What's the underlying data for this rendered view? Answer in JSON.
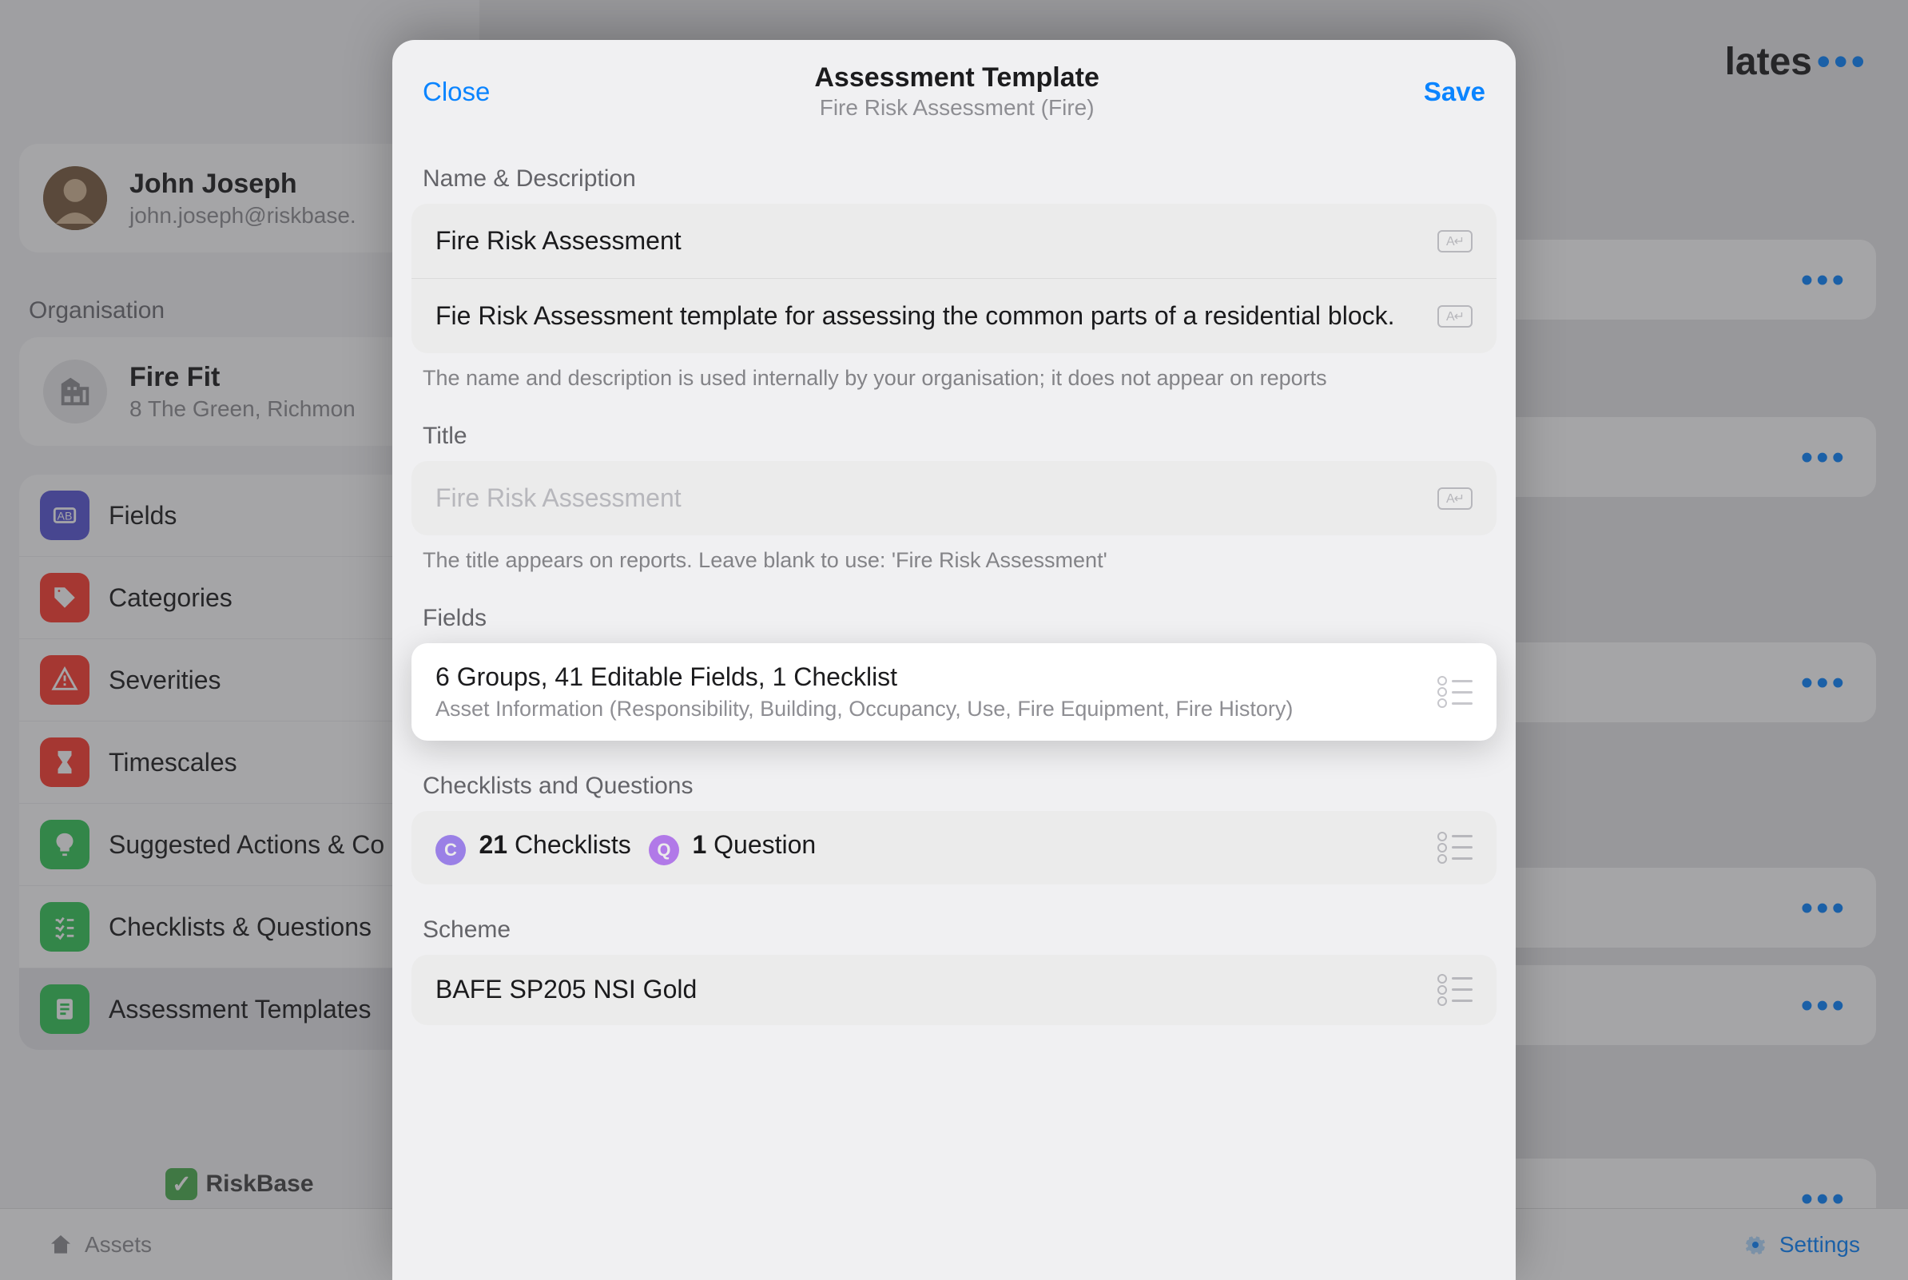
{
  "header": {
    "page_title_visible_part": "lates",
    "full_page_title": "Assessment Templates"
  },
  "user": {
    "name": "John Joseph",
    "email": "john.joseph@riskbase."
  },
  "organisation": {
    "section_label": "Organisation",
    "name": "Fire Fit",
    "address": "8 The Green, Richmon"
  },
  "menu": [
    {
      "label": "Fields",
      "color": "#5856d6",
      "icon": "ab"
    },
    {
      "label": "Categories",
      "color": "#ff3b30",
      "icon": "tag"
    },
    {
      "label": "Severities",
      "color": "#ff3b30",
      "icon": "warn"
    },
    {
      "label": "Timescales",
      "color": "#ff3b30",
      "icon": "hourglass"
    },
    {
      "label": "Suggested Actions & Co",
      "color": "#34c759",
      "icon": "bulb"
    },
    {
      "label": "Checklists & Questions",
      "color": "#34c759",
      "icon": "check"
    },
    {
      "label": "Assessment Templates",
      "color": "#34c759",
      "icon": "doc",
      "active": true
    }
  ],
  "brand": {
    "name": "RiskBase"
  },
  "bottombar": {
    "assets": "Assets",
    "settings": "Settings"
  },
  "modal": {
    "close": "Close",
    "save": "Save",
    "title": "Assessment Template",
    "subtitle": "Fire Risk Assessment (Fire)",
    "sections": {
      "name_desc": {
        "label": "Name & Description",
        "name_value": "Fire Risk Assessment",
        "desc_value": "Fie Risk Assessment template for assessing the common parts of a residential block.",
        "helper": "The name and description is used internally by your organisation; it does not appear on reports"
      },
      "title": {
        "label": "Title",
        "placeholder": "Fire Risk Assessment",
        "helper": "The title appears on reports. Leave blank to use: 'Fire Risk Assessment'"
      },
      "fields": {
        "label": "Fields",
        "summary": "6 Groups, 41 Editable Fields, 1 Checklist",
        "detail": "Asset Information (Responsibility, Building, Occupancy, Use, Fire Equipment, Fire History)"
      },
      "checklists": {
        "label": "Checklists and Questions",
        "c_badge": "C",
        "c_count": "21",
        "c_label": "Checklists",
        "q_badge": "Q",
        "q_count": "1",
        "q_label": "Question"
      },
      "scheme": {
        "label": "Scheme",
        "value": "BAFE SP205 NSI Gold"
      }
    }
  }
}
